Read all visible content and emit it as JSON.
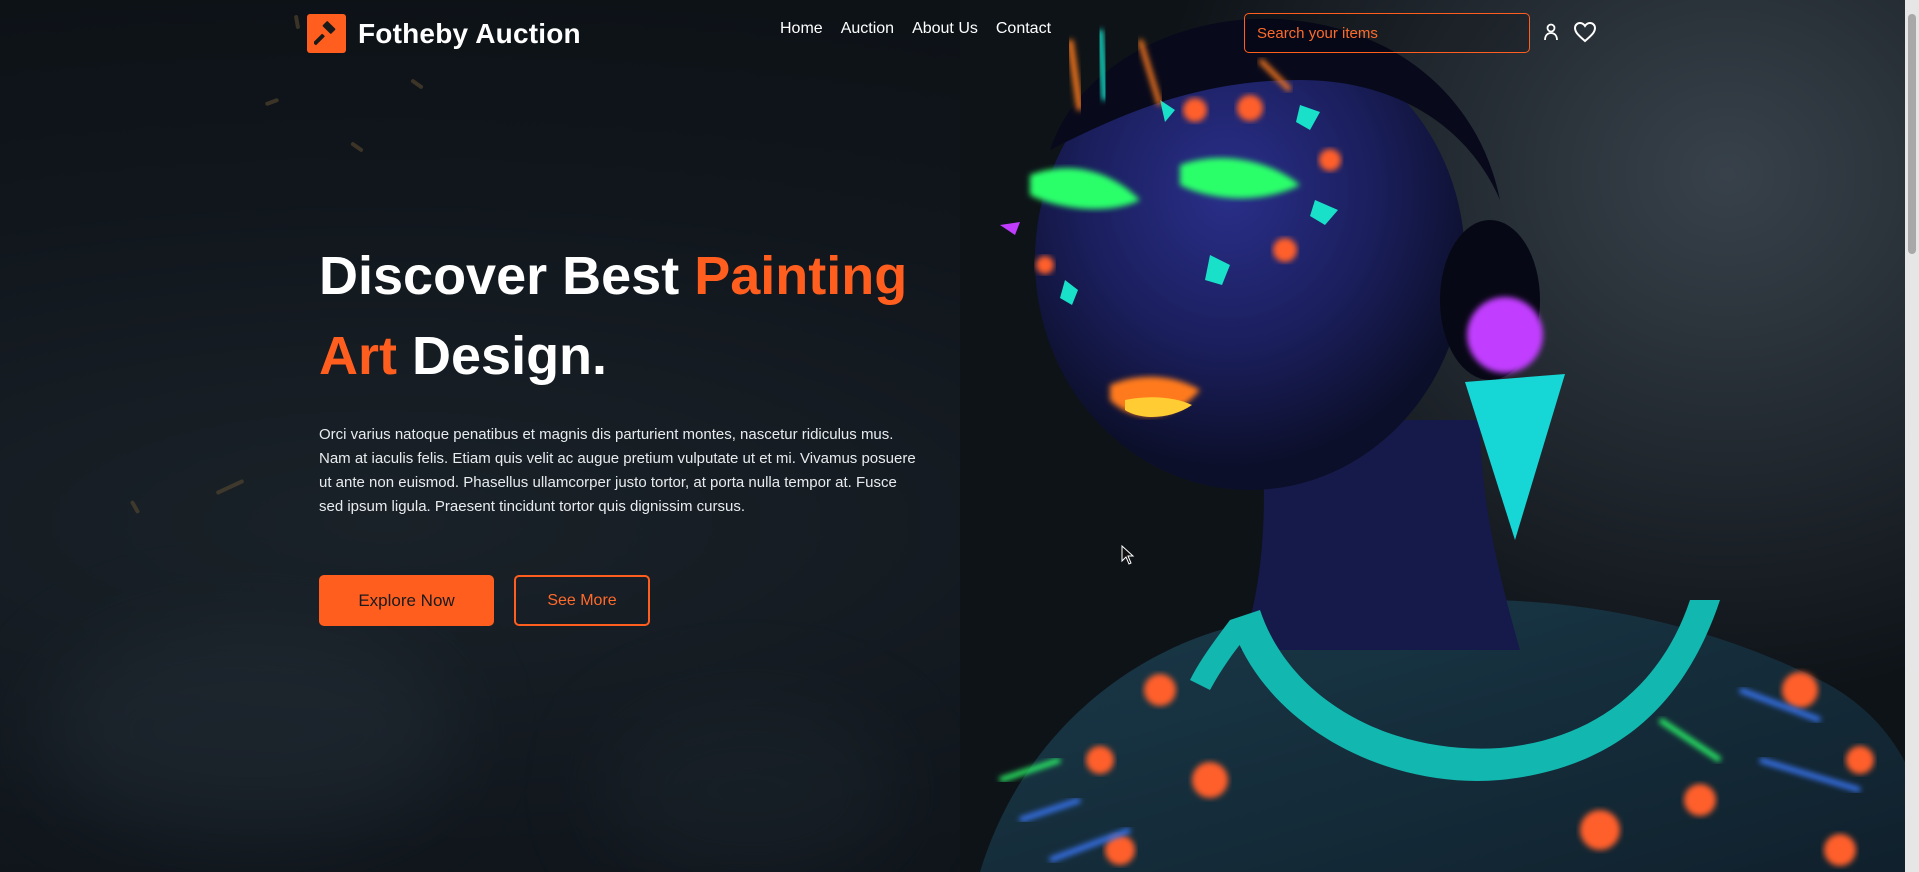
{
  "brand": {
    "name": "Fotheby Auction",
    "icon": "gavel-icon",
    "accent_color": "#ff5e1f"
  },
  "nav": {
    "links": [
      {
        "label": "Home"
      },
      {
        "label": "Auction"
      },
      {
        "label": "About Us"
      },
      {
        "label": "Contact"
      }
    ]
  },
  "search": {
    "placeholder": "Search your items",
    "value": ""
  },
  "icons": {
    "user": "user-icon",
    "wishlist": "heart-icon"
  },
  "hero": {
    "title_part1": "Discover Best ",
    "title_accent1": "Painting",
    "title_accent2": "Art",
    "title_part2": " Design.",
    "body": "Orci varius natoque penatibus et magnis dis parturient montes, nascetur ridiculus mus. Nam at iaculis felis. Etiam quis velit ac augue pretium vulputate ut et mi. Vivamus posuere ut ante non euismod. Phasellus ullamcorper justo tortor, at porta nulla tempor at. Fusce sed ipsum ligula. Praesent tincidunt tortor quis dignissim cursus.",
    "primary_button": "Explore Now",
    "secondary_button": "See More"
  }
}
